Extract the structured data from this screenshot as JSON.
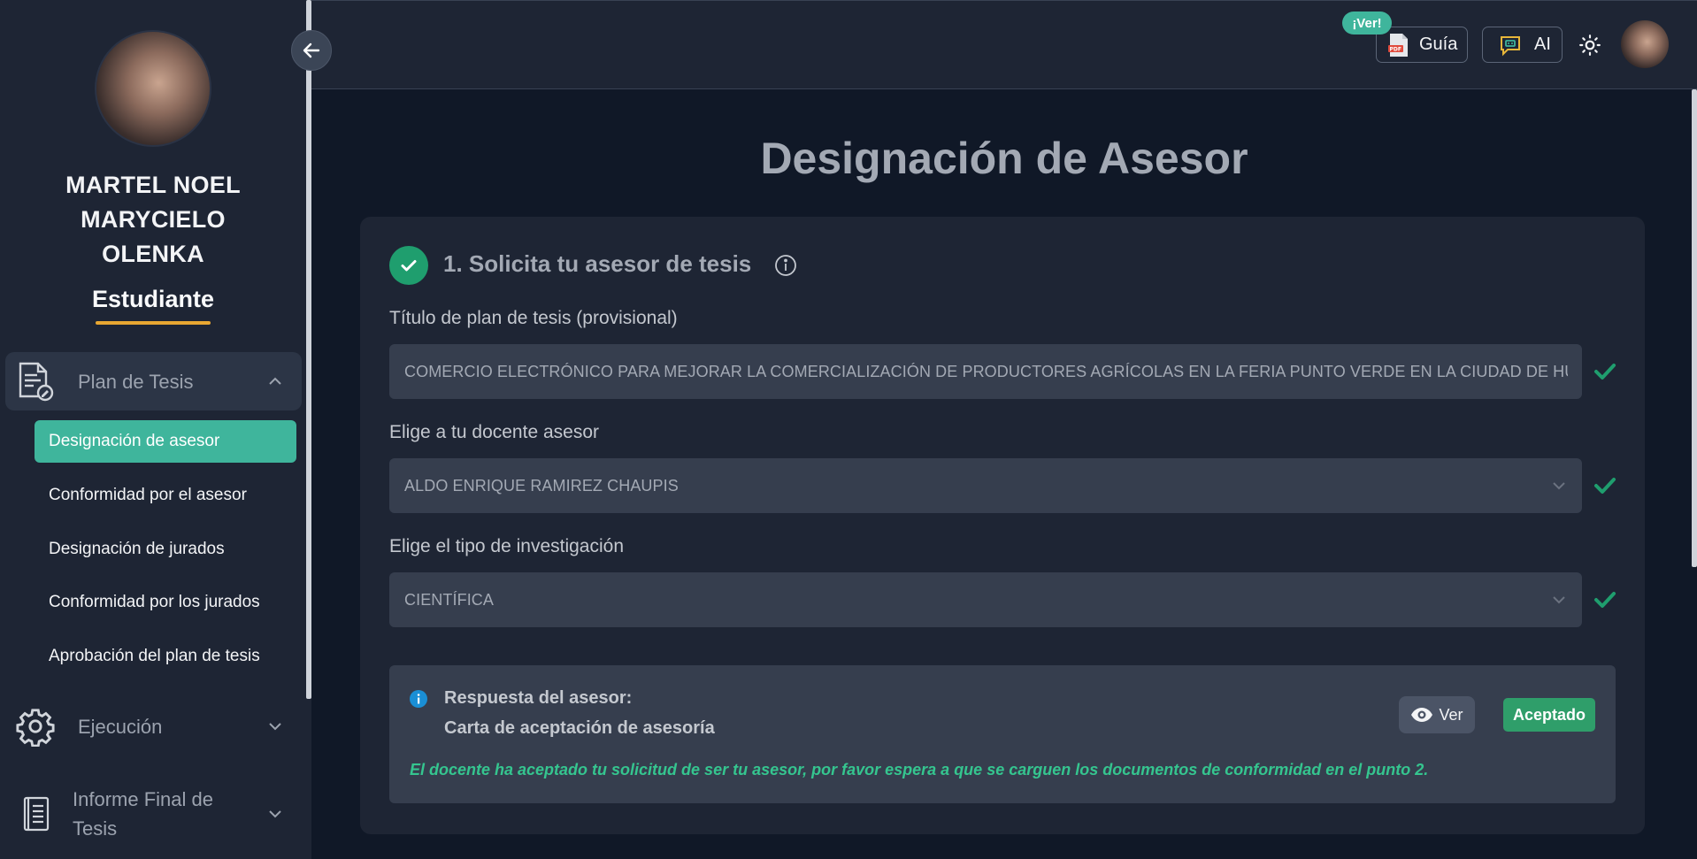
{
  "sidebar": {
    "user_name": "MARTEL NOEL MARYCIELO OLENKA",
    "user_name_lines": [
      "MARTEL NOEL",
      "MARYCIELO",
      "OLENKA"
    ],
    "user_role": "Estudiante",
    "groups": [
      {
        "label": "Plan de Tesis",
        "icon": "document-edit-icon",
        "expanded": true
      },
      {
        "label": "Ejecución",
        "icon": "gear-icon",
        "expanded": false
      },
      {
        "label": "Informe Final de Tesis",
        "label_lines": [
          "Informe Final de",
          "Tesis"
        ],
        "icon": "book-icon",
        "expanded": false
      }
    ],
    "sub_items": [
      {
        "label": "Designación de asesor",
        "active": true
      },
      {
        "label": "Conformidad por el asesor",
        "active": false
      },
      {
        "label": "Designación de jurados",
        "active": false
      },
      {
        "label": "Conformidad por los jurados",
        "active": false
      },
      {
        "label": "Aprobación del plan de tesis",
        "active": false
      }
    ]
  },
  "topbar": {
    "guide_badge": "¡Ver!",
    "guide_label": "Guía",
    "guide_icon": "pdf-icon",
    "ai_label": "AI",
    "ai_icon": "ai-bot-icon",
    "theme_icon": "sun-icon",
    "collapse_icon": "arrow-left-icon"
  },
  "main": {
    "page_title": "Designación de Asesor",
    "step": {
      "title": "1. Solicita tu asesor de tesis",
      "completed": true
    },
    "fields": {
      "thesis_title_label": "Título de plan de tesis (provisional)",
      "thesis_title_value": "COMERCIO ELECTRÓNICO PARA MEJORAR LA COMERCIALIZACIÓN DE PRODUCTORES AGRÍCOLAS EN LA FERIA PUNTO VERDE EN LA CIUDAD DE HUÁNUCO",
      "advisor_label": "Elige a tu docente asesor",
      "advisor_value": "ALDO ENRIQUE RAMIREZ CHAUPIS",
      "research_type_label": "Elige el tipo de investigación",
      "research_type_value": "CIENTÍFICA"
    },
    "response": {
      "title": "Respuesta del asesor:",
      "subtitle": "Carta de aceptación de asesoría",
      "view_label": "Ver",
      "status_label": "Aceptado",
      "message": "El docente ha aceptado tu solicitud de ser tu asesor, por favor espera a que se carguen los documentos de conformidad en el punto 2."
    }
  },
  "colors": {
    "accent": "#3fb59c",
    "success": "#1f9e6e",
    "warning_underline": "#e8a732",
    "message_green": "#35c58f",
    "info_blue": "#1a8fd6"
  }
}
